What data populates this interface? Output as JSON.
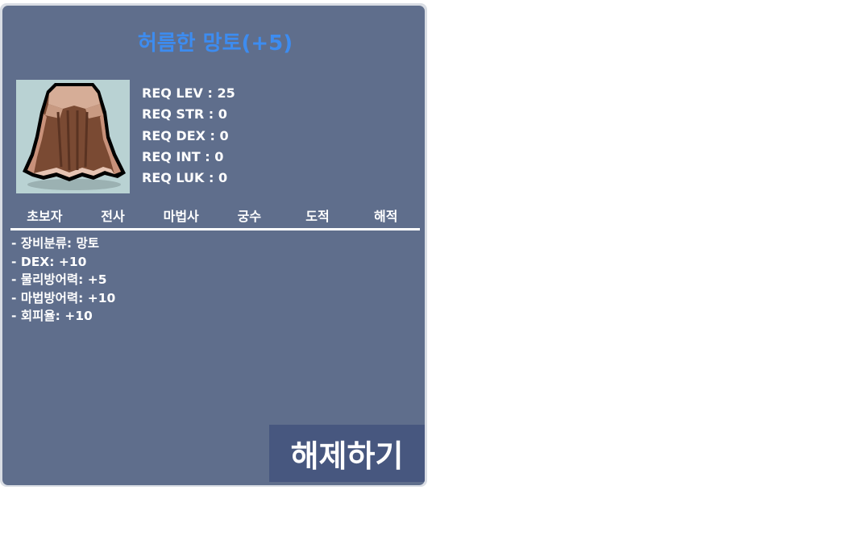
{
  "item": {
    "title": "허름한 망토(+5)",
    "image": "brown-cape-icon"
  },
  "requirements": [
    "REQ LEV : 25",
    "REQ STR : 0",
    "REQ DEX : 0",
    "REQ INT : 0",
    "REQ LUK : 0"
  ],
  "jobs": [
    "초보자",
    "전사",
    "마법사",
    "궁수",
    "도적",
    "해적"
  ],
  "stats": [
    "- 장비분류: 망토",
    "- DEX: +10",
    "- 물리방어력: +5",
    "- 마법방어력: +10",
    "- 회피율: +10"
  ],
  "actions": {
    "release_label": "해제하기"
  },
  "colors": {
    "panel": "#5f6e8c",
    "title": "#3d8cf0",
    "button": "#47577f"
  }
}
